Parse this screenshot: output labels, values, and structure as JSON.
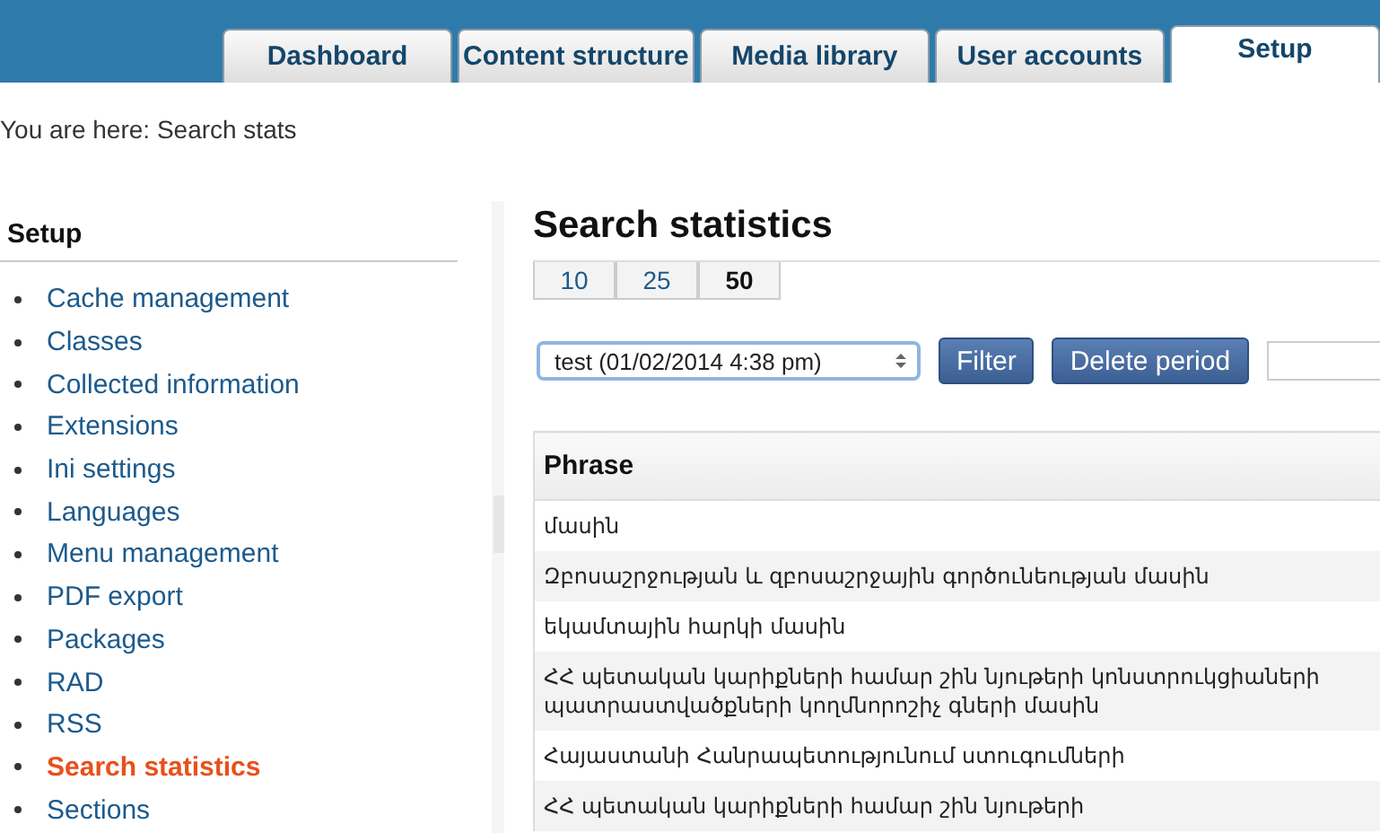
{
  "tabs": [
    {
      "label": "Dashboard",
      "selected": false
    },
    {
      "label": "Content structure",
      "selected": false
    },
    {
      "label": "Media library",
      "selected": false
    },
    {
      "label": "User accounts",
      "selected": false
    },
    {
      "label": "Setup",
      "selected": true
    }
  ],
  "breadcrumb": "You are here: Search stats",
  "sidebar": {
    "title": "Setup",
    "items": [
      {
        "label": "Cache management",
        "selected": false
      },
      {
        "label": "Classes",
        "selected": false
      },
      {
        "label": "Collected information",
        "selected": false
      },
      {
        "label": "Extensions",
        "selected": false
      },
      {
        "label": "Ini settings",
        "selected": false
      },
      {
        "label": "Languages",
        "selected": false
      },
      {
        "label": "Menu management",
        "selected": false
      },
      {
        "label": "PDF export",
        "selected": false
      },
      {
        "label": "Packages",
        "selected": false
      },
      {
        "label": "RAD",
        "selected": false
      },
      {
        "label": "RSS",
        "selected": false
      },
      {
        "label": "Search statistics",
        "selected": true
      },
      {
        "label": "Sections",
        "selected": false
      }
    ]
  },
  "heading": "Search statistics",
  "page_sizes": [
    {
      "label": "10",
      "selected": false
    },
    {
      "label": "25",
      "selected": false
    },
    {
      "label": "50",
      "selected": true
    }
  ],
  "period_select": {
    "value": "test (01/02/2014 4:38 pm)"
  },
  "buttons": [
    "Filter",
    "Delete period"
  ],
  "table": {
    "columns": [
      "Phrase"
    ],
    "rows": [
      [
        "մասին"
      ],
      [
        "Զբոսաշրջության և զբոսաշրջային գործունեության մասին"
      ],
      [
        "եկամտային հարկի մասին"
      ],
      [
        "ՀՀ պետական կարիքների համար շին նյութերի կոնստրուկցիաների պատրաստվածքների կողմնորոշիչ գների մասին"
      ],
      [
        "Հայաստանի Հանրապետությունում ստուգումների"
      ],
      [
        "ՀՀ պետական կարիքների համար շին նյութերի"
      ]
    ]
  }
}
